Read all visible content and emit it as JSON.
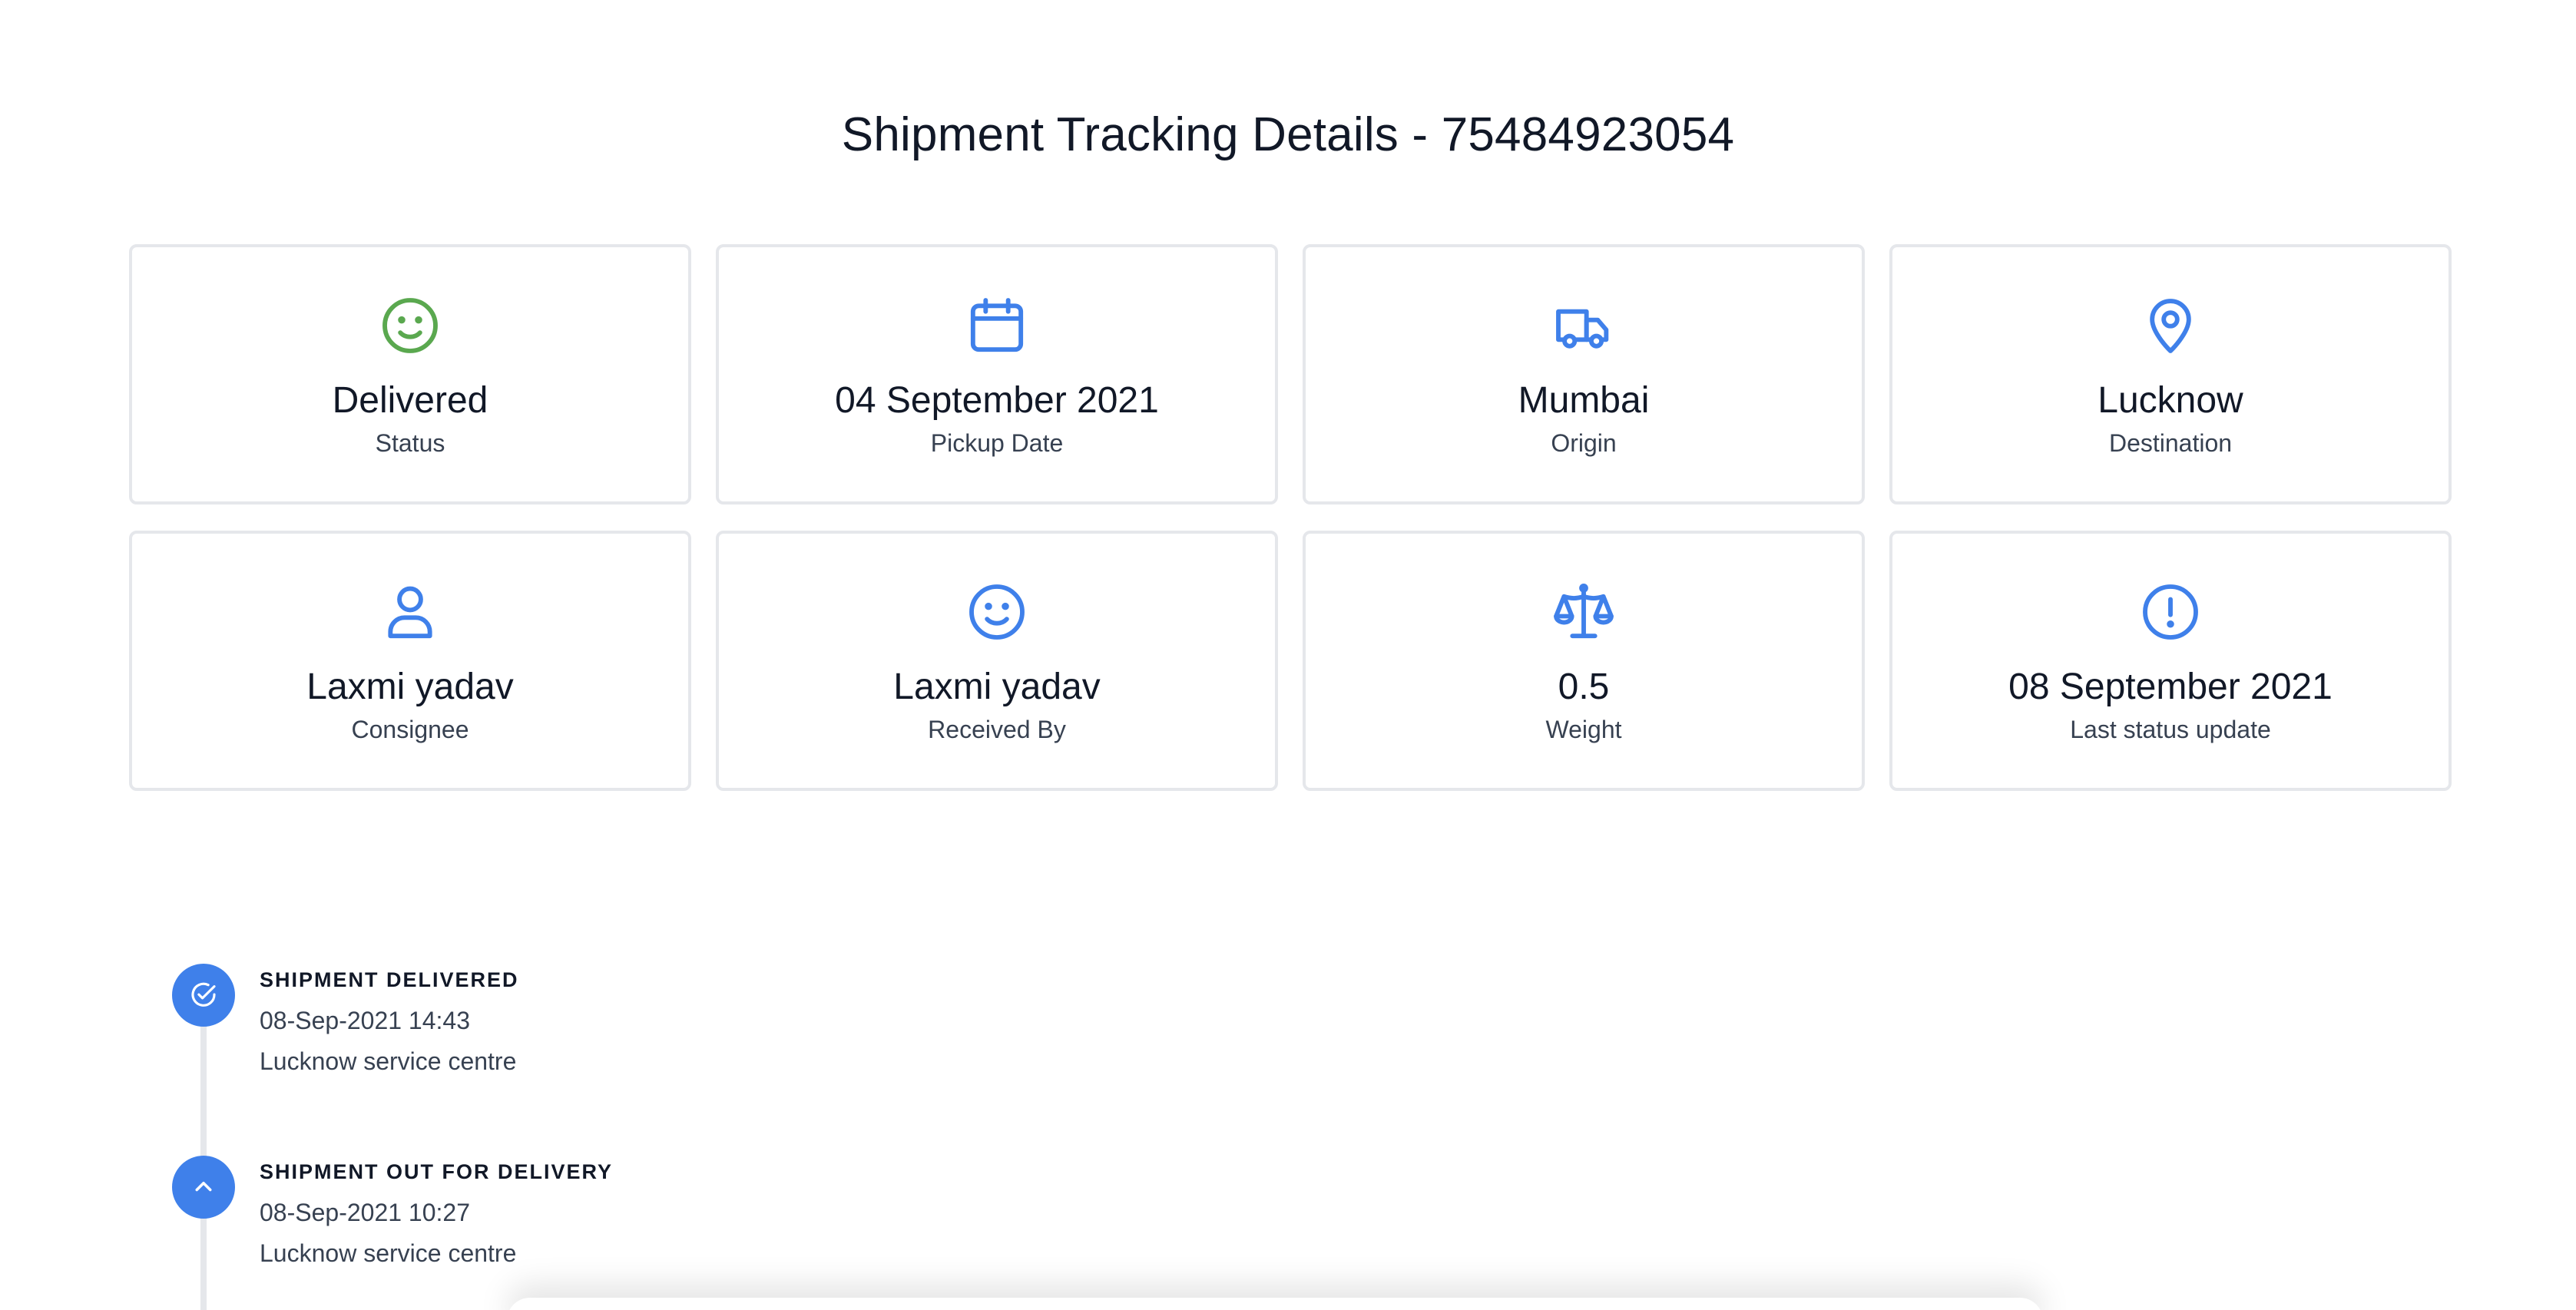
{
  "page": {
    "title": "Shipment Tracking Details - 75484923054"
  },
  "colors": {
    "accent": "#3f80ea",
    "success": "#5aa84f",
    "border": "#e5e7eb",
    "text": "#111827",
    "muted": "#374151"
  },
  "cards": [
    {
      "value": "Delivered",
      "label": "Status",
      "icon": "smiley-icon",
      "icon_color": "#5aa84f"
    },
    {
      "value": "04 September 2021",
      "label": "Pickup Date",
      "icon": "calendar-icon",
      "icon_color": "#3f80ea"
    },
    {
      "value": "Mumbai",
      "label": "Origin",
      "icon": "truck-icon",
      "icon_color": "#3f80ea"
    },
    {
      "value": "Lucknow",
      "label": "Destination",
      "icon": "location-pin-icon",
      "icon_color": "#3f80ea"
    },
    {
      "value": "Laxmi yadav",
      "label": "Consignee",
      "icon": "user-icon",
      "icon_color": "#3f80ea"
    },
    {
      "value": "Laxmi yadav",
      "label": "Received By",
      "icon": "smiley-icon",
      "icon_color": "#3f80ea"
    },
    {
      "value": "0.5",
      "label": "Weight",
      "icon": "scale-icon",
      "icon_color": "#3f80ea"
    },
    {
      "value": "08 September 2021",
      "label": "Last status update",
      "icon": "exclamation-circle-icon",
      "icon_color": "#3f80ea"
    }
  ],
  "timeline": [
    {
      "title": "SHIPMENT DELIVERED",
      "time": "08-Sep-2021 14:43",
      "place": "Lucknow service centre",
      "icon": "check-badge-icon"
    },
    {
      "title": "SHIPMENT OUT FOR DELIVERY",
      "time": "08-Sep-2021 10:27",
      "place": "Lucknow service centre",
      "icon": "chevron-up-icon"
    }
  ]
}
